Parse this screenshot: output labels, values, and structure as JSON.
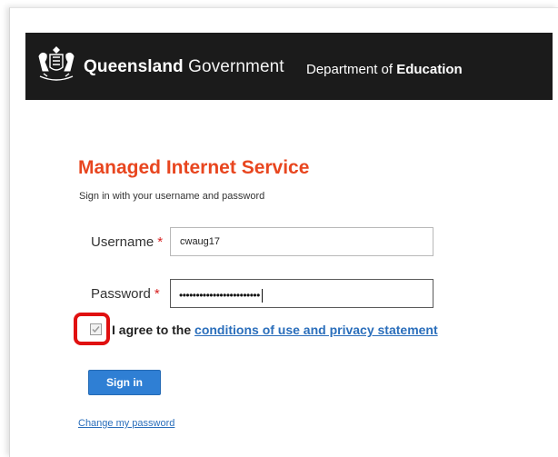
{
  "header": {
    "brand_bold": "Queensland",
    "brand_light": " Government",
    "dept_prefix": "Department of ",
    "dept_bold": "Education",
    "crest_icon": "queensland-crest-icon"
  },
  "form": {
    "title": "Managed Internet Service",
    "subtitle": "Sign in with your username and password",
    "username_label": "Username",
    "username_value": "cwaug17",
    "password_label": "Password",
    "password_mask": "••••••••••••••••••••••••",
    "required_marker": "*",
    "agree_text": "I agree to the ",
    "agree_link": "conditions of use and privacy statement",
    "agree_checked": true,
    "signin_label": "Sign in",
    "change_password_link": "Change my password"
  },
  "colors": {
    "header_bg": "#1b1b1b",
    "title": "#e8461f",
    "link": "#2a6ebb",
    "button": "#2f7fd4",
    "highlight": "#e01010"
  }
}
